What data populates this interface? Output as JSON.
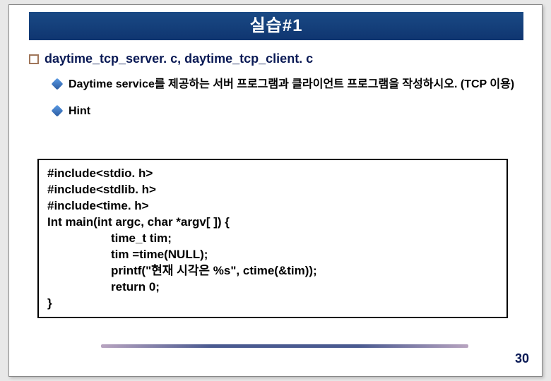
{
  "title": "실습#1",
  "bullet1": "daytime_tcp_server. c, daytime_tcp_client. c",
  "sub1": "Daytime service를 제공하는 서버 프로그램과 클라이언트 프로그램을 작성하시오. (TCP 이용)",
  "sub2": "Hint",
  "code": {
    "l1": "#include<stdio. h>",
    "l2": "#include<stdlib. h>",
    "l3": "#include<time. h>",
    "l4": "Int main(int argc, char *argv[ ]) {",
    "l5": "time_t tim;",
    "l6": "tim =time(NULL);",
    "l7": "printf(\"현재 시각은 %s\", ctime(&tim));",
    "l8": "return 0;",
    "l9": "}"
  },
  "page": "30"
}
